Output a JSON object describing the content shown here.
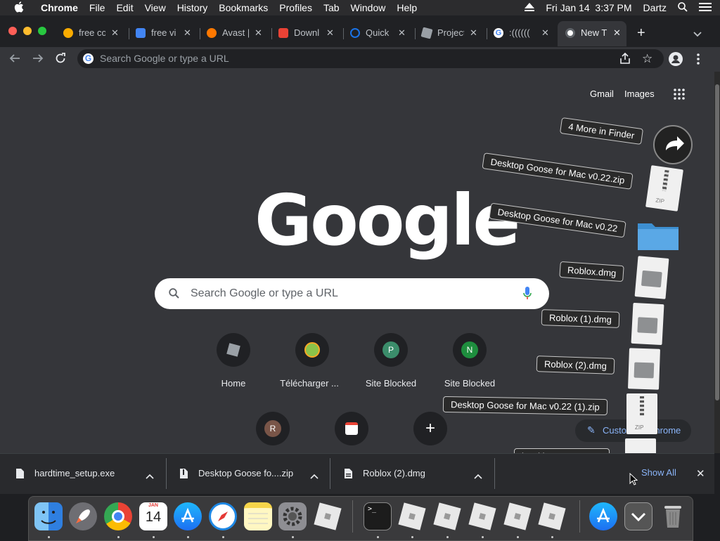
{
  "menubar": {
    "apple": "",
    "items": [
      "Chrome",
      "File",
      "Edit",
      "View",
      "History",
      "Bookmarks",
      "Profiles",
      "Tab",
      "Window",
      "Help"
    ],
    "datetime": "Fri Jan 14  3:37 PM",
    "user": "Dartz"
  },
  "tabs": [
    {
      "title": "free co",
      "color": "#f9ab00"
    },
    {
      "title": "free vi",
      "color": "#4285f4"
    },
    {
      "title": "Avast |",
      "color": "#ff7800"
    },
    {
      "title": "Downl",
      "color": "#e94235"
    },
    {
      "title": "Quick",
      "color": "#1a73e8"
    },
    {
      "title": "Project",
      "color": "#9aa0a6"
    },
    {
      "title": ":((((((",
      "color": "#ffffff"
    },
    {
      "title": "New T",
      "color": "#ffffff"
    }
  ],
  "toolbar": {
    "omnibox_placeholder": "Search Google or type a URL"
  },
  "ntp": {
    "gmail": "Gmail",
    "images": "Images",
    "logo": "Google",
    "search_placeholder": "Search Google or type a URL",
    "shortcuts": [
      {
        "label": "Home",
        "badge": ""
      },
      {
        "label": "Télécharger ...",
        "badge": ""
      },
      {
        "label": "Site Blocked",
        "badge": "P"
      },
      {
        "label": "Site Blocked",
        "badge": "N"
      }
    ],
    "shortcuts_row2": [
      {
        "label": "",
        "badge": "R"
      },
      {
        "label": "",
        "badge": ""
      },
      {
        "label": "",
        "badge": "+"
      }
    ],
    "customize": "Customize Chrome"
  },
  "stack": {
    "more": "4 More in Finder",
    "items": [
      "Desktop Goose for Mac v0.22.zip",
      "Desktop Goose for Mac v0.22",
      "Roblox.dmg",
      "Roblox (1).dmg",
      "Roblox (2).dmg",
      "Desktop Goose for Mac v0.22 (1).zip",
      "hardtime_setup.exe"
    ],
    "zip_badge": "ZIP"
  },
  "downloads": {
    "items": [
      "hardtime_setup.exe",
      "Desktop Goose fo....zip",
      "Roblox (2).dmg"
    ],
    "show_all": "Show All"
  },
  "dock": {
    "calendar_month": "JAN",
    "calendar_day": "14"
  }
}
